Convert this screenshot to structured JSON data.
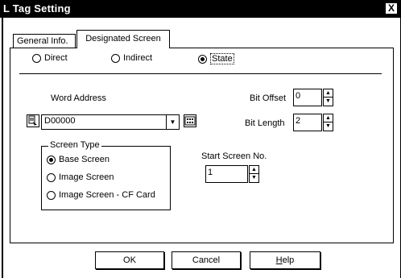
{
  "window": {
    "title": "L Tag Setting",
    "close_glyph": "X"
  },
  "tabs": [
    {
      "label": "General Info."
    },
    {
      "label": "Designated Screen",
      "active": true
    }
  ],
  "mode": {
    "options": [
      {
        "label": "Direct",
        "checked": false
      },
      {
        "label": "Indirect",
        "checked": false
      },
      {
        "label": "State",
        "checked": true
      }
    ]
  },
  "word_address": {
    "label": "Word Address",
    "value": "D00000"
  },
  "bit_offset": {
    "label": "Bit Offset",
    "value": "0"
  },
  "bit_length": {
    "label": "Bit Length",
    "value": "2"
  },
  "screen_type": {
    "title": "Screen Type",
    "options": [
      {
        "label": "Base Screen",
        "checked": true
      },
      {
        "label": "Image Screen",
        "checked": false
      },
      {
        "label": "Image Screen - CF Card",
        "checked": false
      }
    ]
  },
  "start_screen": {
    "label": "Start Screen No.",
    "value": "1"
  },
  "buttons": {
    "ok": "OK",
    "cancel": "Cancel",
    "help_mnemonic": "H",
    "help_rest": "elp"
  },
  "icons": {
    "address_picker": "address-picker-icon",
    "keypad": "keypad-icon",
    "spin_up": "▲",
    "spin_down": "▼",
    "dropdown_arrow": "▼"
  }
}
